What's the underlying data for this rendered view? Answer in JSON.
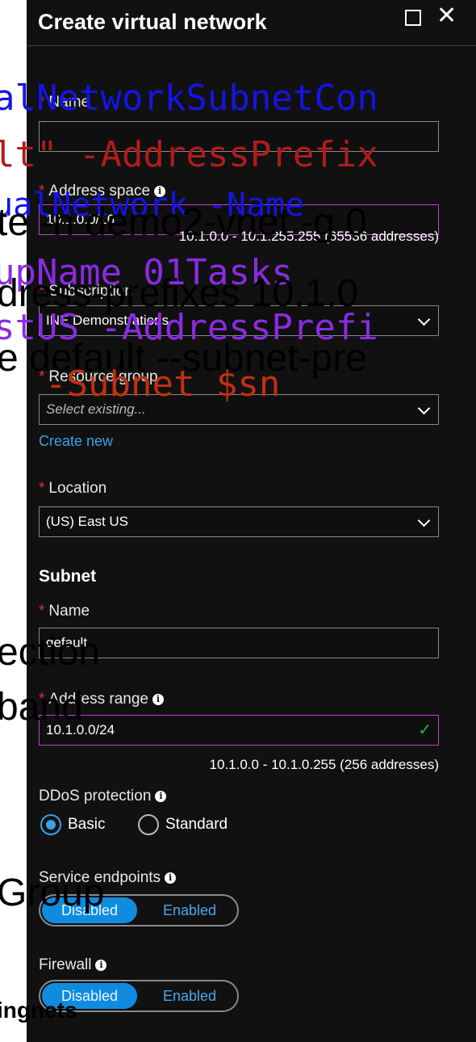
{
  "header": {
    "title": "Create virtual network"
  },
  "form": {
    "name_label": "Name",
    "address_space_label": "Address space",
    "address_space_value": "10.1.0.0/16",
    "address_space_hint": "10.1.0.0 - 10.1.255.255 (65536 addresses)",
    "subscription_label": "Subscription",
    "subscription_value": "INE Demonstrations",
    "resource_group_label": "Resource group",
    "resource_group_placeholder": "Select existing...",
    "create_new": "Create new",
    "location_label": "Location",
    "location_value": "(US) East US"
  },
  "subnet": {
    "heading": "Subnet",
    "name_label": "Name",
    "name_value": "default",
    "range_label": "Address range",
    "range_value": "10.1.0.0/24",
    "range_hint": "10.1.0.0 - 10.1.0.255 (256 addresses)"
  },
  "ddos": {
    "label": "DDoS protection",
    "basic": "Basic",
    "standard": "Standard",
    "selected": "Basic"
  },
  "service_endpoints": {
    "label": "Service endpoints",
    "disabled": "Disabled",
    "enabled": "Enabled",
    "selected": "Disabled"
  },
  "firewall": {
    "label": "Firewall",
    "disabled": "Disabled",
    "enabled": "Enabled",
    "selected": "Disabled"
  },
  "overlays": [
    "alNetworkSubnetCon",
    "lt\" -AddressPrefix",
    "ualNetwork -Name",
    "te -n demo2-vnet -g 0",
    "upName 01Tasks",
    "dress-prefixes 10.1.0",
    "stUS -AddressPrefi",
    "e default --subnet-pre",
    "-Subnet $sn",
    "ection",
    "band",
    "Group",
    "ingnets"
  ],
  "colors": {
    "panel": "#111111",
    "accent": "#3ba0e6",
    "focus": "#c43bd4",
    "required": "#e03030",
    "valid": "#2db34a",
    "overlay_blue": "#1414e6",
    "overlay_purple": "#8a2be2",
    "overlay_red": "#b01c1c",
    "overlay_orange": "#c03010"
  },
  "icons": [
    "maximize-icon",
    "close-icon",
    "info-icon",
    "chevron-down-icon",
    "checkmark-icon"
  ]
}
